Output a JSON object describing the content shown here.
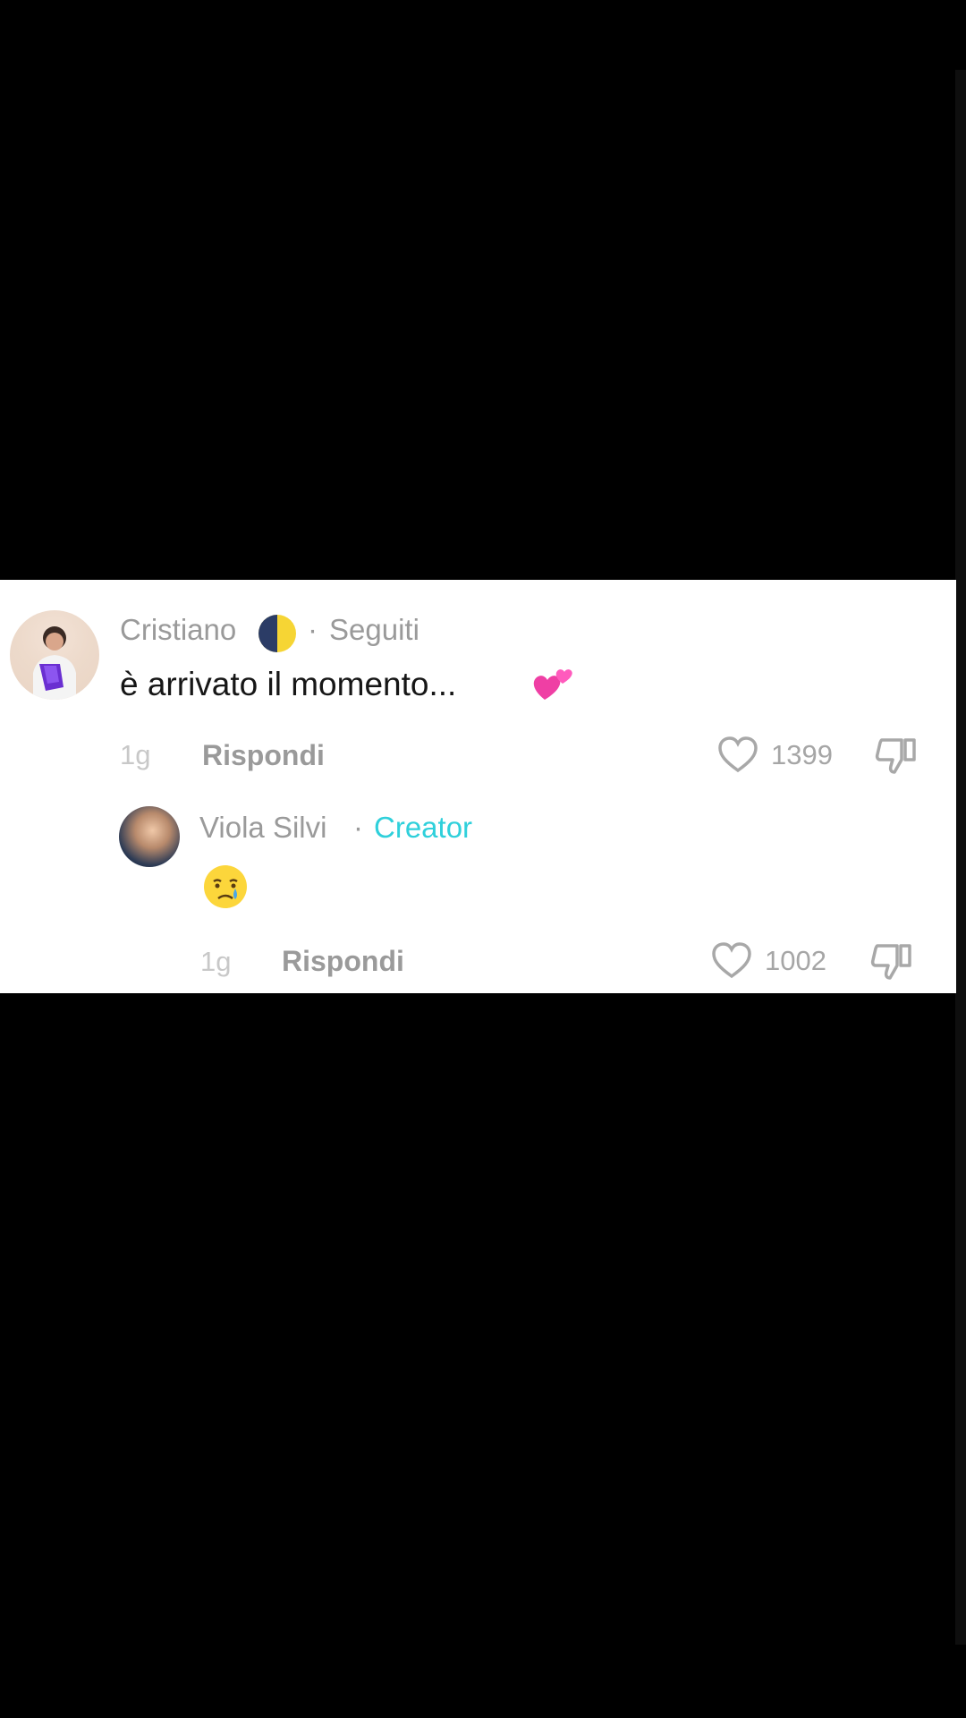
{
  "comment": {
    "author": "Cristiano",
    "separator": "·",
    "relation": "Seguiti",
    "text": "è arrivato il momento...",
    "time": "1g",
    "reply_label": "Rispondi",
    "likes": "1399"
  },
  "reply": {
    "author": "Viola Silvi",
    "separator": "·",
    "badge": "Creator",
    "time": "1g",
    "reply_label": "Rispondi",
    "likes": "1002"
  },
  "icons": {
    "flag": "half-moon-flag-icon",
    "hearts": "two-hearts-emoji",
    "cry": "crying-face-emoji",
    "like": "heart-outline-icon",
    "dislike": "thumbs-down-icon"
  },
  "colors": {
    "background": "#000000",
    "panel": "#ffffff",
    "creator_badge": "#2fd0db"
  }
}
